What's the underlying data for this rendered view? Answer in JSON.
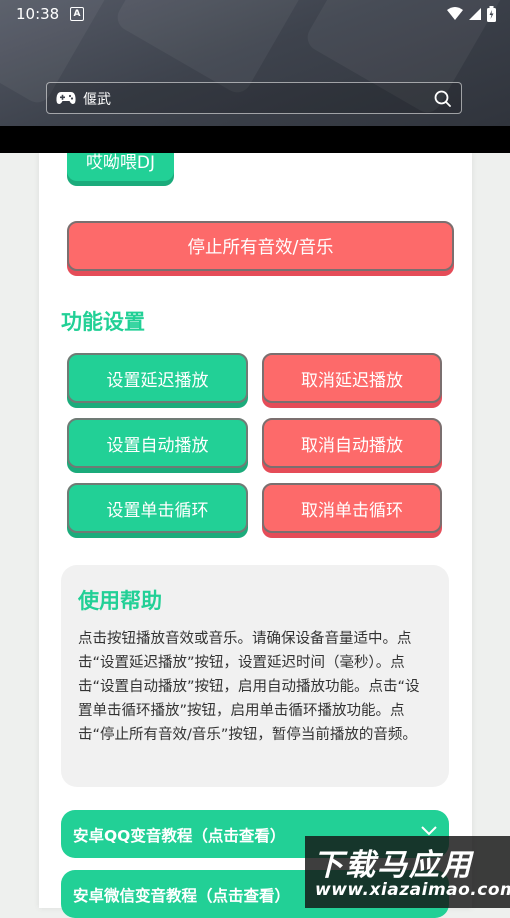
{
  "status_bar": {
    "time": "10:38",
    "notification_letter": "A"
  },
  "search": {
    "query": "偃武"
  },
  "sound_buttons": [
    {
      "label": "哎呦喂DJ"
    }
  ],
  "stop_all": {
    "label": "停止所有音效/音乐"
  },
  "function_settings": {
    "title": "功能设置",
    "buttons": [
      {
        "label": "设置延迟播放",
        "variant": "green"
      },
      {
        "label": "取消延迟播放",
        "variant": "red"
      },
      {
        "label": "设置自动播放",
        "variant": "green"
      },
      {
        "label": "取消自动播放",
        "variant": "red"
      },
      {
        "label": "设置单击循环",
        "variant": "green"
      },
      {
        "label": "取消单击循环",
        "variant": "red"
      }
    ]
  },
  "help": {
    "title": "使用帮助",
    "text": "点击按钮播放音效或音乐。请确保设备音量适中。点击“设置延迟播放”按钮，设置延迟时间（毫秒）。点击“设置自动播放”按钮，启用自动播放功能。点击“设置单击循环播放”按钮，启用单击循环播放功能。点击“停止所有音效/音乐”按钮，暂停当前播放的音频。"
  },
  "tutorials": [
    {
      "label": "安卓QQ变音教程（点击查看）"
    },
    {
      "label": "安卓微信变音教程（点击查看）"
    }
  ],
  "watermark": {
    "line1": "下载马应用",
    "line2": "www.xiazaimao.com"
  },
  "colors": {
    "green": "#22d096",
    "red": "#fd6a6a",
    "header": "#3e434d"
  }
}
